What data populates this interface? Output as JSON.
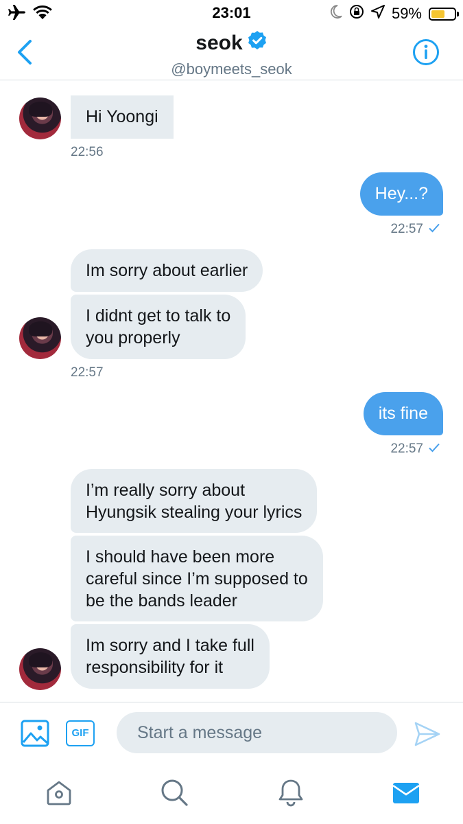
{
  "status_bar": {
    "time": "23:01",
    "battery_text": "59%",
    "battery_level": 0.59,
    "icons": [
      "airplane-icon",
      "wifi-icon",
      "moon-icon",
      "rotation-lock-icon",
      "location-icon",
      "battery-icon"
    ]
  },
  "header": {
    "name": "seok",
    "handle": "@boymeets_seok",
    "verified": true,
    "accent_color": "#1da1f2"
  },
  "messages": [
    {
      "side": "received",
      "text": "Hi Yoongi"
    },
    {
      "side": "received_time",
      "text": "22:56"
    },
    {
      "side": "sent",
      "text": "Hey...?"
    },
    {
      "side": "sent_time",
      "text": "22:57"
    },
    {
      "side": "received",
      "text": "Im sorry about earlier"
    },
    {
      "side": "received",
      "text": "I didnt get to talk to\nyou properly"
    },
    {
      "side": "received_time",
      "text": "22:57"
    },
    {
      "side": "sent",
      "text": "its fine"
    },
    {
      "side": "sent_time",
      "text": "22:57"
    },
    {
      "side": "received",
      "text": "I’m really sorry about\nHyungsik stealing your lyrics"
    },
    {
      "side": "received",
      "text": "I should have been more\ncareful since I’m supposed to\nbe the bands leader"
    },
    {
      "side": "received",
      "text": "Im sorry and I take full\nresponsibility for it"
    }
  ],
  "composer": {
    "gif_label": "GIF",
    "placeholder": "Start a message",
    "value": ""
  },
  "colors": {
    "sent_bubble": "#4aa1ec",
    "received_bubble": "#e6ecf0",
    "secondary_text": "#657786",
    "battery": "#f5c531"
  },
  "tabbar": {
    "items": [
      "home-icon",
      "search-icon",
      "notifications-icon",
      "messages-icon"
    ],
    "active": "messages-icon"
  }
}
